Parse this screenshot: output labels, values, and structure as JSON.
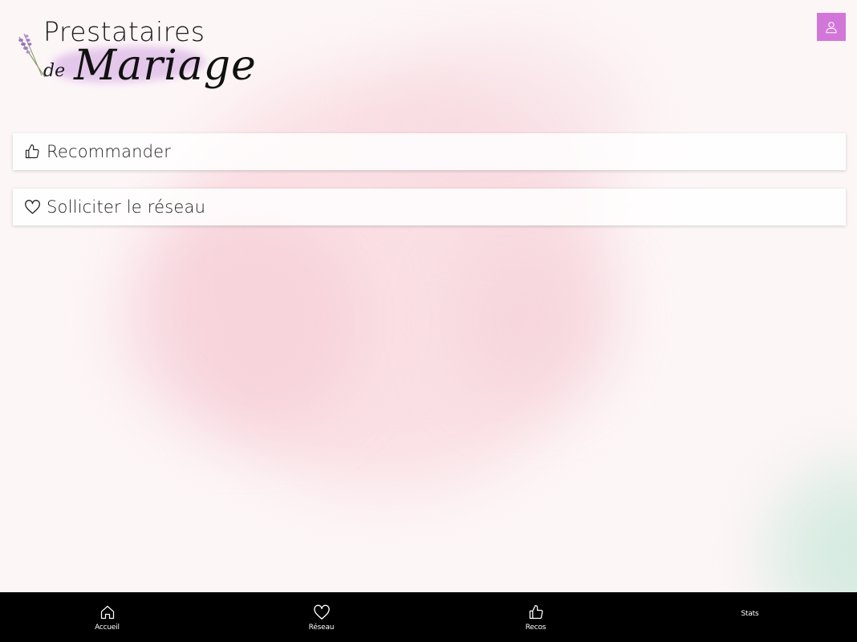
{
  "brand": {
    "line1": "Prestataires",
    "de": "de",
    "line2": "Mariage"
  },
  "header": {
    "profile_icon": "user-icon",
    "accent_color": "#d277d9"
  },
  "actions": [
    {
      "label": "Recommander",
      "icon": "thumbs-up-icon"
    },
    {
      "label": "Solliciter le réseau",
      "icon": "heart-icon"
    }
  ],
  "bottom_nav": {
    "items": [
      {
        "label": "Accueil",
        "icon": "home-icon"
      },
      {
        "label": "Réseau",
        "icon": "heart-icon"
      },
      {
        "label": "Recos",
        "icon": "thumbs-up-icon"
      },
      {
        "label": "Stats",
        "icon": ""
      }
    ]
  }
}
